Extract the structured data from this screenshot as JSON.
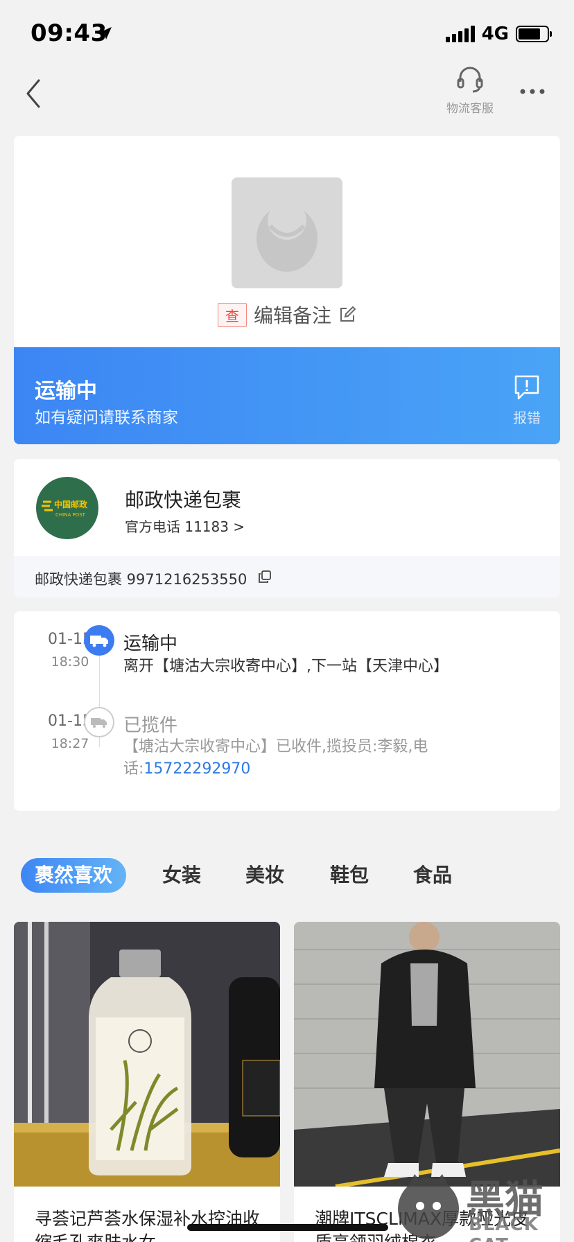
{
  "status_bar": {
    "time": "09:43",
    "network": "4G",
    "battery_level": 0.78
  },
  "nav": {
    "cs_label": "物流客服"
  },
  "package": {
    "check_badge": "查",
    "remark": "编辑备注"
  },
  "shipping_status": {
    "title": "运输中",
    "subtitle": "如有疑问请联系商家",
    "report_label": "报错"
  },
  "carrier": {
    "name": "邮政快递包裹",
    "phone": "官方电话 11183 >",
    "logo_text": "中国邮政",
    "logo_sub": "CHINA POST",
    "tracking": "邮政快递包裹 9971216253550"
  },
  "timeline": [
    {
      "date": "01-15",
      "time": "18:30",
      "title": "运输中",
      "desc": "离开【塘沽大宗收寄中心】,下一站【天津中心】"
    },
    {
      "date": "01-15",
      "time": "18:27",
      "title": "已揽件",
      "desc": "【塘沽大宗收寄中心】已收件,揽投员:李毅,电话:",
      "phone": "15722292970"
    }
  ],
  "tabs": [
    "裹然喜欢",
    "女装",
    "美妆",
    "鞋包",
    "食品"
  ],
  "products": [
    {
      "title": "寻荟记芦荟水保湿补水控油收缩毛孔爽肤水女"
    },
    {
      "title": "潮牌ITSCLIMAX厚款哑光皮质高领羽绒棉衣"
    }
  ],
  "watermark": {
    "text": "黑猫",
    "sub": "BLACK CAT"
  },
  "colors": {
    "accent": "#3c86f4",
    "link": "#2e7ae6",
    "badge_red": "#e64a3b",
    "post_green": "#2f6e4b"
  }
}
